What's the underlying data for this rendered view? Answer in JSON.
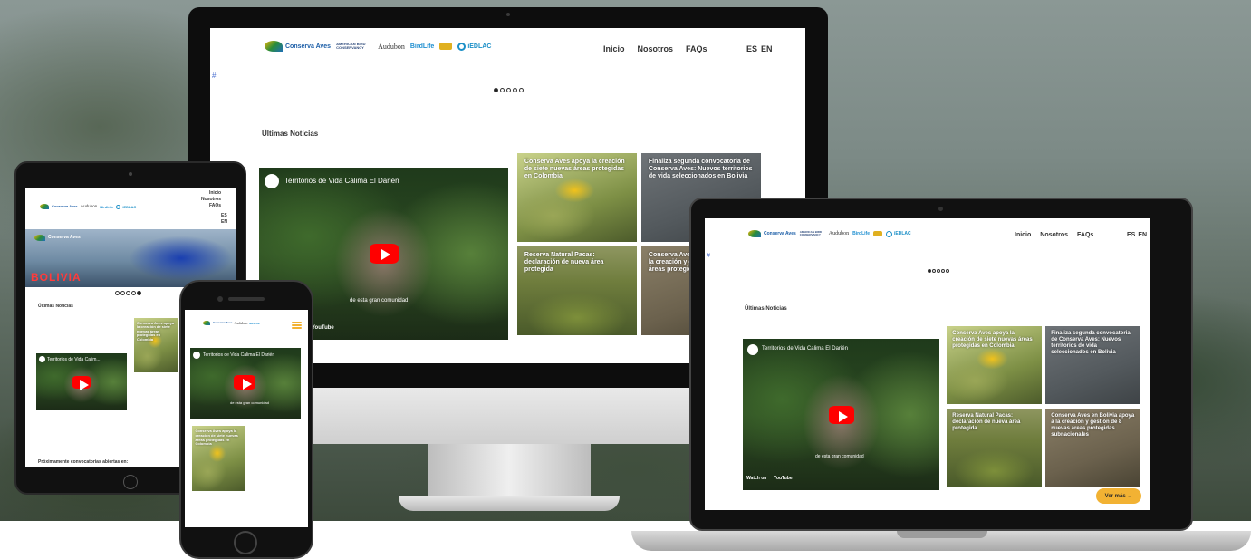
{
  "site": {
    "logos": {
      "conserva_aves": "Conserva Aves",
      "abc": "AMERICAN BIRD CONSERVANCY",
      "audubon": "Audubon",
      "birdlife": "BirdLife",
      "iedlac": "iEDLAC",
      "tagline": "iniciativa de"
    },
    "nav": {
      "inicio": "Inicio",
      "nosotros": "Nosotros",
      "faqs": "FAQs",
      "es": "ES",
      "en": "EN"
    },
    "broken_image": "#",
    "section_title": "Últimas Noticias",
    "video": {
      "title": "Territorios de Vida Calima El Darién",
      "title_short": "Territorios de Vida Calim...",
      "caption": "de esta gran comunidad",
      "watch_on": "Watch on",
      "youtube": "YouTube"
    },
    "news": [
      {
        "title": "Conserva Aves apoya la creación de siete nuevas áreas protegidas en Colombia"
      },
      {
        "title": "Finaliza segunda convocatoria de Conserva Aves: Nuevos territorios de vida seleccionados en Bolivia"
      },
      {
        "title": "Reserva Natural Pacas: declaración de nueva área protegida"
      },
      {
        "title": "Conserva Aves en Bolivia apoya a la creación y gestión de 8 nuevas áreas protegidas subnacionales"
      }
    ],
    "more_button": "Ver más →",
    "banner_word": "BOLIVIA",
    "proximamente": "Próximamente convocatorias abiertas en:"
  },
  "colors": {
    "accent": "#f2b233",
    "youtube_red": "#ff0000",
    "brand_blue": "#1d5fa8"
  }
}
